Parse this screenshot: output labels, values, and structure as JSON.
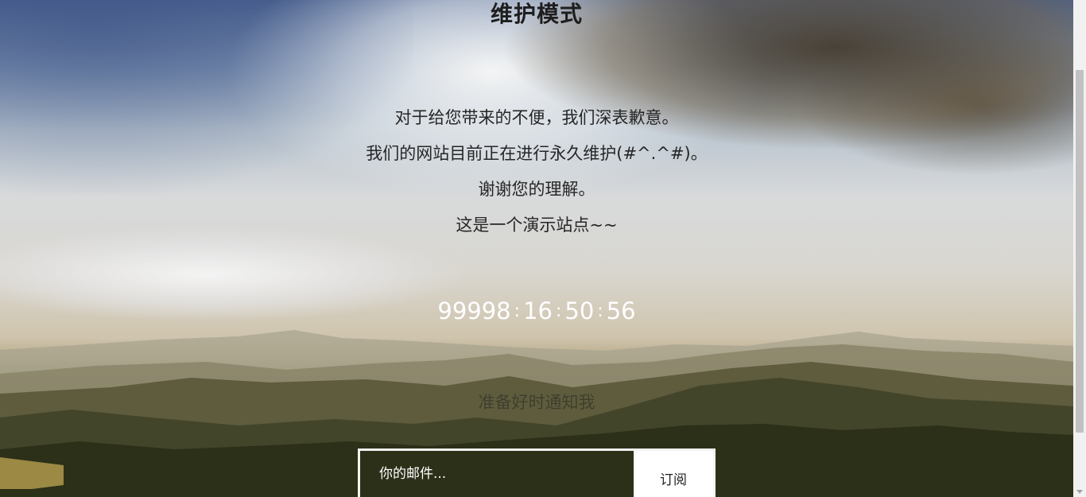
{
  "page": {
    "title": "维护模式",
    "message_lines": [
      "对于给您带来的不便，我们深表歉意。",
      "我们的网站目前正在进行永久维护(#^.^#)。",
      "谢谢您的理解。",
      "这是一个演示站点~~"
    ],
    "countdown": {
      "days": "99998",
      "hours": "16",
      "minutes": "50",
      "seconds": "56",
      "separator": ":"
    },
    "notify_text": "准备好时通知我",
    "subscribe": {
      "email_placeholder": "你的邮件...",
      "button_label": "订阅"
    }
  },
  "colors": {
    "title": "#1e1e1e",
    "countdown": "#ffffff",
    "button_bg": "#ffffff"
  }
}
